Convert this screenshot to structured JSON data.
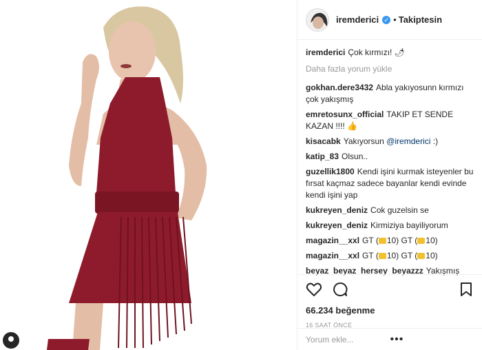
{
  "post": {
    "author": "iremderici",
    "follow_state": "Takiptesin",
    "dot": "•",
    "caption_user": "iremderici",
    "caption_text": "Çok kırmızı! 🌶",
    "load_more": "Daha fazla yorum yükle",
    "likes": "66.234 beğenme",
    "time": "16 SAAT ÖNCE",
    "add_comment_placeholder": "Yorum ekle...",
    "more_label": "•••"
  },
  "comments": [
    {
      "user": "gokhan.dere3432",
      "text": "Abla yakıyosunn kırmızı çok yakışmış"
    },
    {
      "user": "emretosunx_official",
      "text": "TAKIP ET SENDE KAZAN !!!! 👍"
    },
    {
      "user": "kisacabk",
      "text": "Yakıyorsun",
      "mention": "@iremderici",
      "suffix": " :)"
    },
    {
      "user": "katip_83",
      "text": "Olsun.."
    },
    {
      "user": "guzellik1800",
      "text": "Kendi işini kurmak isteyenler bu fırsat kaçmaz sadece bayanlar kendi evinde kendi işini yap"
    },
    {
      "user": "kukreyen_deniz",
      "text": "Cok guzelsin se"
    },
    {
      "user": "kukreyen_deniz",
      "text": "Kirmiziya bayiliyorum"
    },
    {
      "user": "magazin__xxl",
      "text": "GT (",
      "coin_text": "10) GT (",
      "coin_text2": "10)"
    },
    {
      "user": "magazin__xxl",
      "text": "GT (",
      "coin_text": "10) GT (",
      "coin_text2": "10)"
    },
    {
      "user": "beyaz_beyaz_hersey_beyazzz",
      "text": "Yakışmış"
    }
  ],
  "icons": {
    "like": "heart-icon",
    "comment": "comment-icon",
    "save": "bookmark-icon",
    "verified": "verified-badge-icon"
  },
  "colors": {
    "dress": "#8e1b2c",
    "accent": "#3897f0",
    "text": "#262626",
    "muted": "#999999"
  }
}
